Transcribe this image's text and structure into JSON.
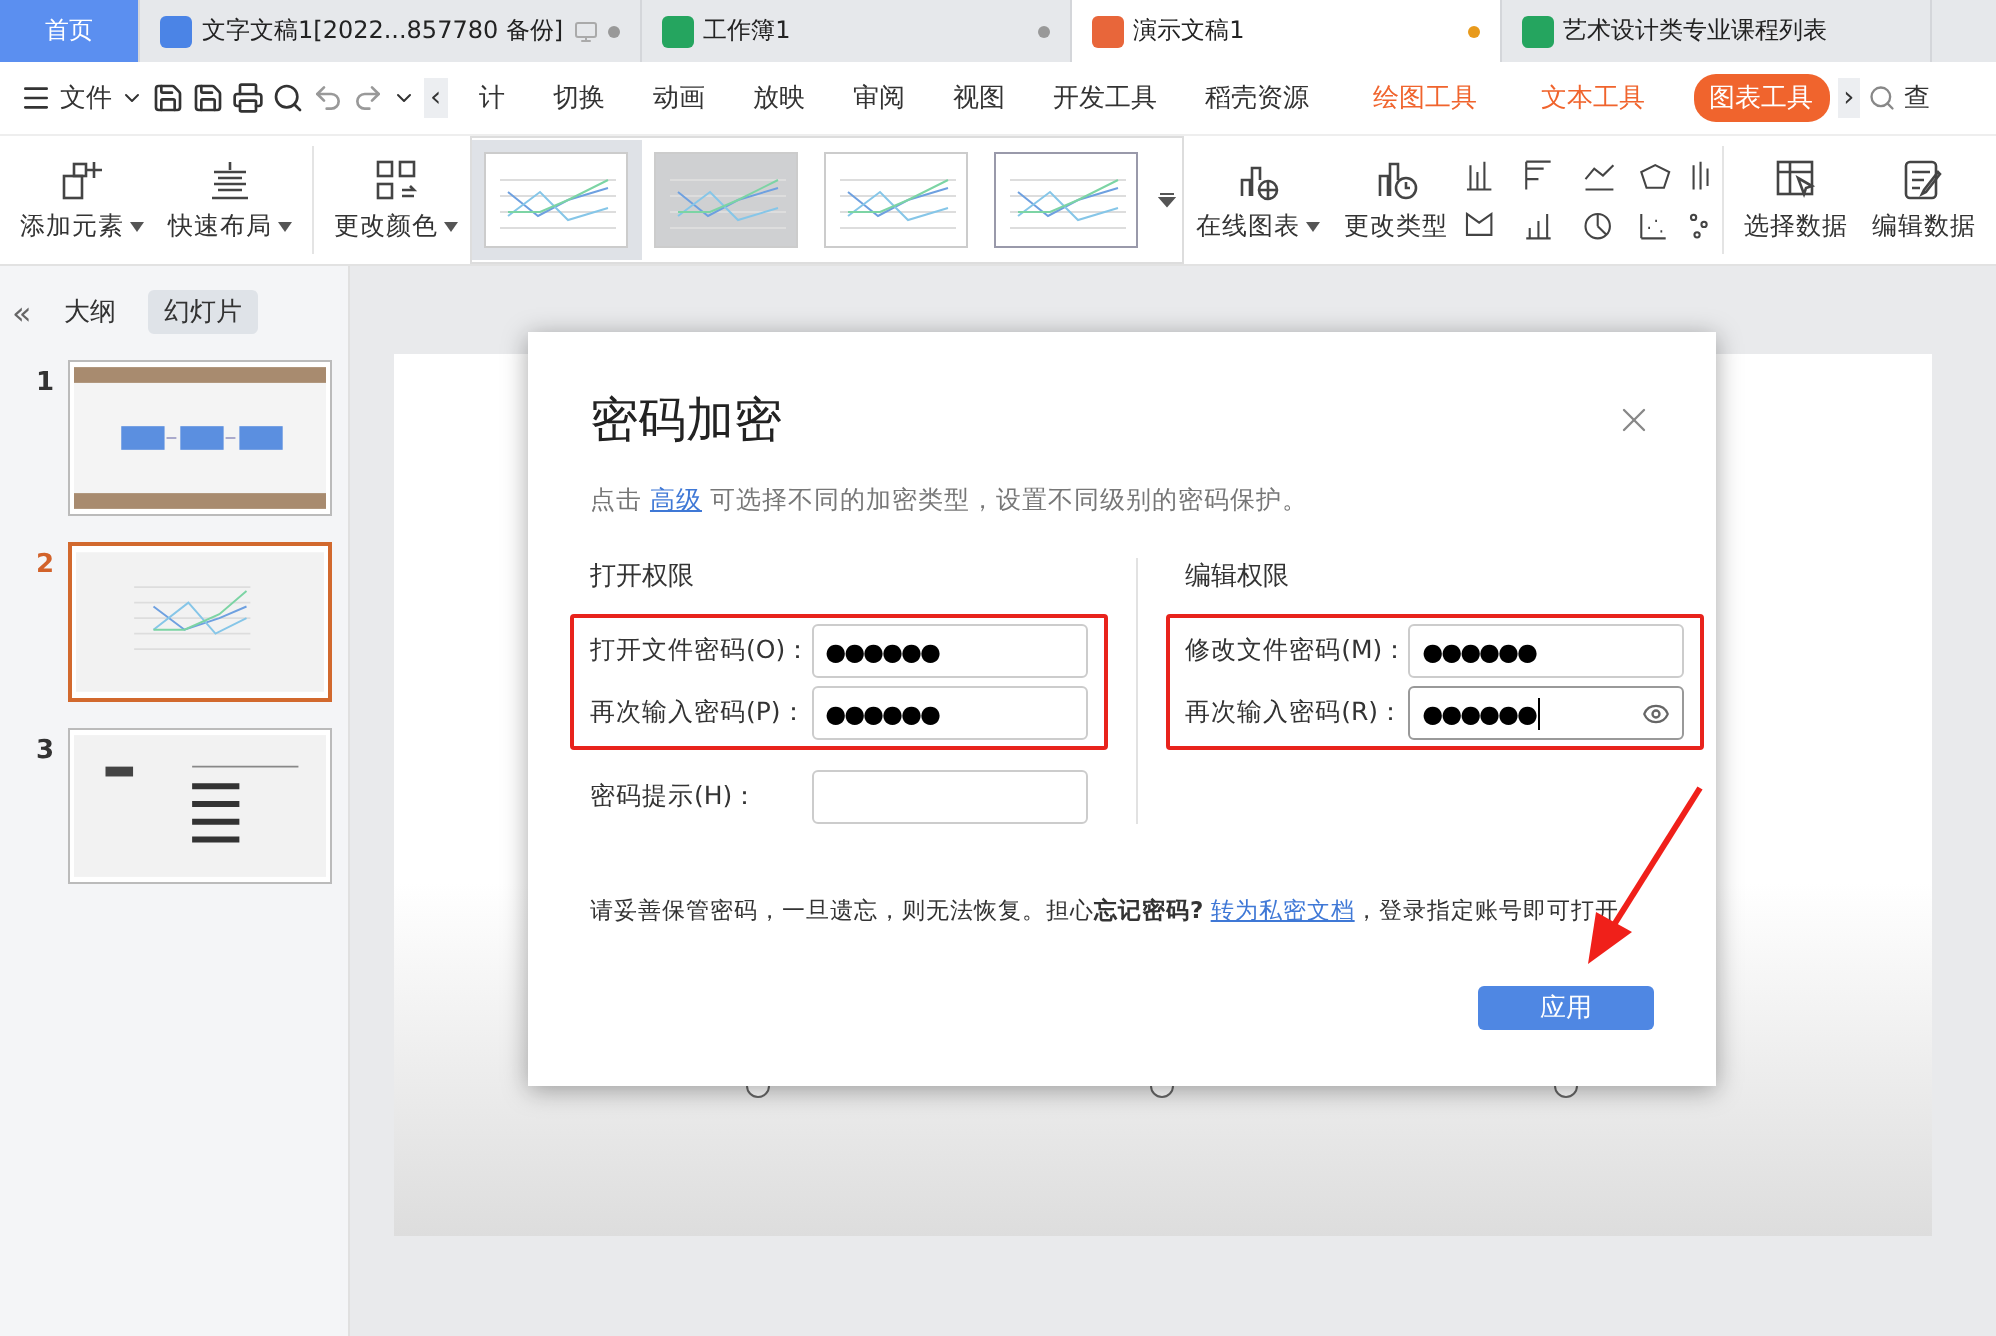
{
  "tabs": [
    {
      "label": "首页",
      "kind": "home",
      "selected": false
    },
    {
      "label": "文字文稿1[2022...857780 备份]",
      "kind": "writer",
      "selected": false,
      "unsaved": false
    },
    {
      "label": "工作簿1",
      "kind": "sheet",
      "selected": false,
      "unsaved": false
    },
    {
      "label": "演示文稿1",
      "kind": "slides",
      "selected": true,
      "unsaved": true
    },
    {
      "label": "艺术设计类专业课程列表",
      "kind": "sheet",
      "selected": false
    }
  ],
  "menu": {
    "file": "文件",
    "prev": "‹",
    "next": "›",
    "search": "查",
    "items": [
      {
        "label": "计",
        "kind": "plain",
        "selected": false
      },
      {
        "label": "切换",
        "kind": "plain",
        "selected": false
      },
      {
        "label": "动画",
        "kind": "plain",
        "selected": false
      },
      {
        "label": "放映",
        "kind": "plain",
        "selected": false
      },
      {
        "label": "审阅",
        "kind": "plain",
        "selected": false
      },
      {
        "label": "视图",
        "kind": "plain",
        "selected": false
      },
      {
        "label": "开发工具",
        "kind": "plain",
        "selected": false
      },
      {
        "label": "稻壳资源",
        "kind": "plain",
        "selected": false
      },
      {
        "label": "绘图工具",
        "kind": "context",
        "selected": false
      },
      {
        "label": "文本工具",
        "kind": "context",
        "selected": false
      },
      {
        "label": "图表工具",
        "kind": "context",
        "selected": true
      }
    ]
  },
  "ribbon": {
    "left": [
      {
        "label": "添加元素",
        "kind": "add",
        "dropdown": true
      },
      {
        "label": "快速布局",
        "kind": "layout",
        "dropdown": true
      },
      {
        "label": "更改颜色",
        "kind": "color",
        "dropdown": true
      }
    ],
    "styles": [
      {
        "selected": true,
        "kind": "light"
      },
      {
        "selected": false,
        "kind": "gray"
      },
      {
        "selected": false,
        "kind": "light"
      },
      {
        "selected": false,
        "kind": "framed"
      }
    ],
    "right": [
      {
        "label": "在线图表",
        "kind": "online",
        "dropdown": true
      },
      {
        "label": "更改类型",
        "kind": "type",
        "dropdown": false
      }
    ],
    "data": [
      {
        "label": "选择数据",
        "kind": "select",
        "dropdown": false
      },
      {
        "label": "编辑数据",
        "kind": "edit",
        "dropdown": false
      }
    ]
  },
  "sidebar": {
    "collapse": "«",
    "tabs": [
      {
        "label": "大纲",
        "selected": false
      },
      {
        "label": "幻灯片",
        "selected": true
      }
    ],
    "slides": [
      {
        "number": "1",
        "kind": "flow",
        "selected": false
      },
      {
        "number": "2",
        "kind": "chart",
        "selected": true
      },
      {
        "number": "3",
        "kind": "toc",
        "selected": false
      }
    ]
  },
  "dialog": {
    "title": "密码加密",
    "intro": {
      "before": "点击",
      "link": "高级",
      "after": "可选择不同的加密类型，设置不同级别的密码保护。"
    },
    "sections": [
      {
        "title": "打开权限",
        "marked_fields": [
          {
            "label": "打开文件密码(O)：",
            "value": "●●●●●●",
            "focused": false
          },
          {
            "label": "再次输入密码(P)：",
            "value": "●●●●●●",
            "focused": false
          }
        ],
        "fields": [
          {
            "label": "密码提示(H)：",
            "focused": false
          }
        ]
      },
      {
        "title": "编辑权限",
        "marked_fields": [
          {
            "label": "修改文件密码(M)：",
            "value": "●●●●●●",
            "focused": false
          },
          {
            "label": "再次输入密码(R)：",
            "value": "●●●●●●",
            "focused": true,
            "reveal": true
          }
        ]
      }
    ],
    "note": {
      "text": "请妥善保管密码，一旦遗忘，则无法恢复。担心**忘记密码?**",
      "link": "转为私密文档",
      "after": "，登录指定账号即可打开"
    },
    "apply": {
      "label": "应用",
      "pointed": true
    }
  }
}
